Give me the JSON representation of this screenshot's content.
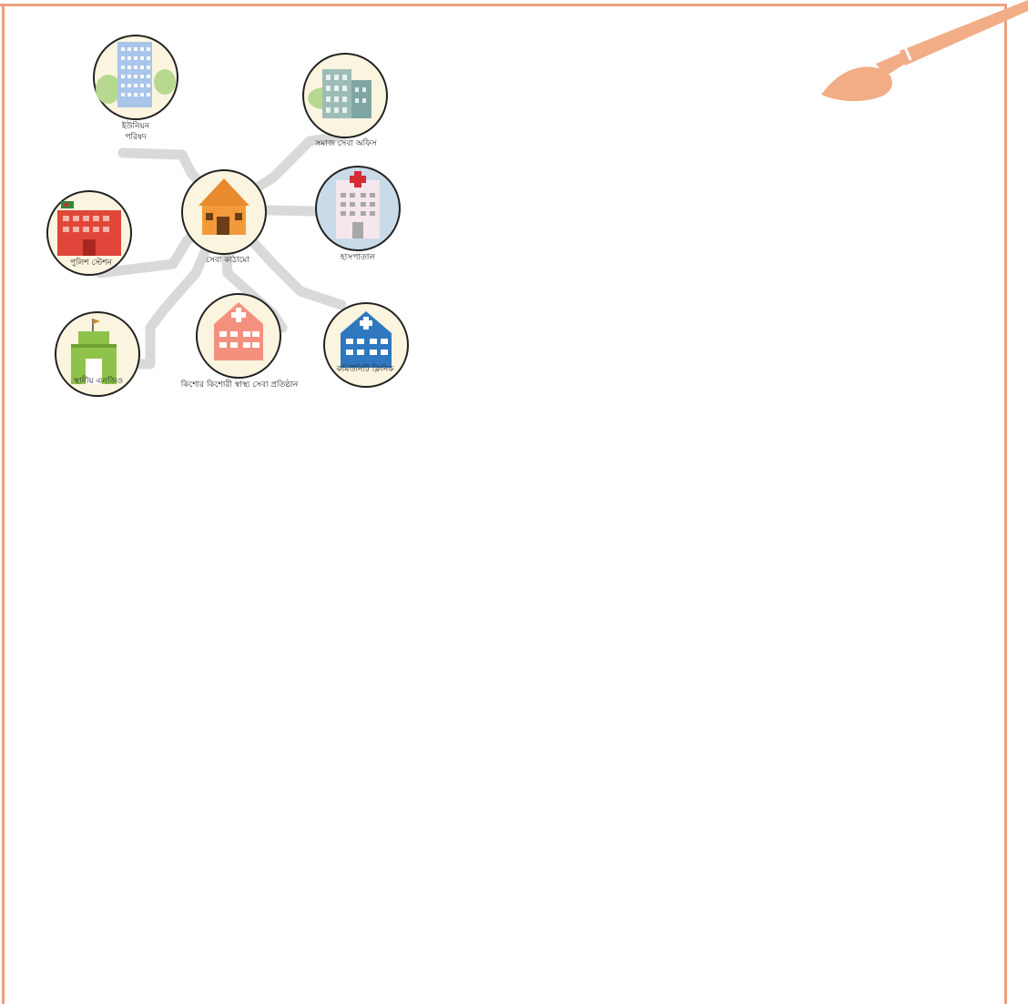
{
  "colors": {
    "frame": "#e9a27f",
    "paths": "#d9d9d9",
    "circle_fill": "#fbf5df",
    "circle_stroke": "#222222",
    "brush": "#f2ad86"
  },
  "diagram": {
    "center": {
      "label": "সেবা কাঠামো",
      "icon": "house-icon"
    },
    "nodes": [
      {
        "id": "union-parishad",
        "label_lines": [
          "ইউনিয়ন",
          "পরিষদ"
        ],
        "icon": "office-tower-icon"
      },
      {
        "id": "social-service",
        "label_lines": [
          "সমাজ সেবা অফিস"
        ],
        "icon": "office-buildings-icon"
      },
      {
        "id": "hospital",
        "label_lines": [
          "হাসপাতাল"
        ],
        "icon": "hospital-icon"
      },
      {
        "id": "police-station",
        "label_lines": [
          "পুলিশ স্টেশন"
        ],
        "icon": "police-station-icon"
      },
      {
        "id": "local-ngo",
        "label_lines": [
          "স্থানীয় এনজিও"
        ],
        "icon": "ngo-building-icon"
      },
      {
        "id": "adolescent-health",
        "label_lines": [
          "কিশোর কিশোরী স্বাস্থ্য সেবা প্রতিষ্ঠান"
        ],
        "icon": "health-center-icon"
      },
      {
        "id": "community-clinic",
        "label_lines": [
          "কমিউনিটি ক্লিনিক"
        ],
        "icon": "clinic-icon"
      }
    ]
  }
}
